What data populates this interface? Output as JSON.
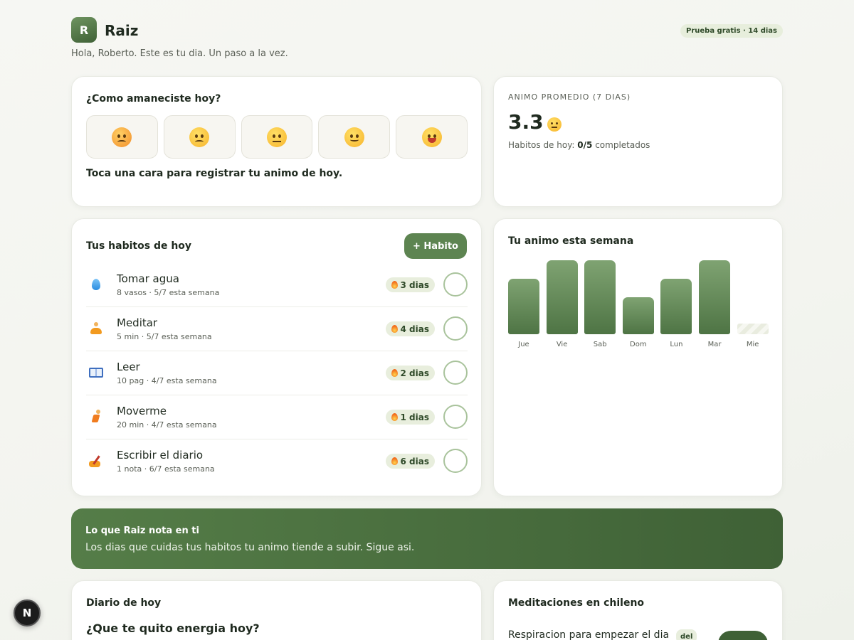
{
  "app": {
    "logo_letter": "R",
    "name": "Raiz",
    "trial_badge": "Prueba gratis · 14 dias",
    "greeting": "Hola, Roberto. Este es tu dia. Un paso a la vez."
  },
  "mood": {
    "title": "¿Como amaneciste hoy?",
    "options": [
      "very-bad-face-icon",
      "sad-face-icon",
      "neutral-face-icon",
      "smile-face-icon",
      "grin-face-icon"
    ],
    "hint": "Toca una cara para registrar tu animo de hoy."
  },
  "average": {
    "label": "ANIMO PROMEDIO (7 DIAS)",
    "value": "3.3",
    "habits_prefix": "Habitos de hoy: ",
    "habits_count": "0/5",
    "habits_suffix": " completados"
  },
  "habits": {
    "title": "Tus habitos de hoy",
    "add_label": "+ Habito",
    "items": [
      {
        "icon": "water-drop-icon",
        "name": "Tomar agua",
        "meta": "8 vasos · 5/7 esta semana",
        "streak": "3 dias"
      },
      {
        "icon": "meditation-icon",
        "name": "Meditar",
        "meta": "5 min · 5/7 esta semana",
        "streak": "4 dias"
      },
      {
        "icon": "book-icon",
        "name": "Leer",
        "meta": "10 pag · 4/7 esta semana",
        "streak": "2 dias"
      },
      {
        "icon": "running-icon",
        "name": "Moverme",
        "meta": "20 min · 4/7 esta semana",
        "streak": "1 dias"
      },
      {
        "icon": "writing-icon",
        "name": "Escribir el diario",
        "meta": "1 nota · 6/7 esta semana",
        "streak": "6 dias"
      }
    ]
  },
  "week": {
    "title": "Tu animo esta semana",
    "days": [
      "Jue",
      "Vie",
      "Sab",
      "Dom",
      "Lun",
      "Mar",
      "Mie"
    ],
    "mood_levels": [
      3,
      4,
      4,
      2,
      3,
      4,
      null
    ],
    "max_level": 4
  },
  "insight": {
    "title": "Lo que Raiz nota en ti",
    "text": "Los dias que cuidas tus habitos tu animo tiende a subir. Sigue asi."
  },
  "diary": {
    "title": "Diario de hoy",
    "question": "¿Que te quito energia hoy?"
  },
  "meditations": {
    "title": "Meditaciones en chileno",
    "first_item": "Respiracion para empezar el dia",
    "first_tag": "del"
  },
  "fab_label": "N",
  "colors": {
    "accent": "#5d8451",
    "accent_dark": "#3f6136",
    "badge_bg": "#e8eedd"
  }
}
